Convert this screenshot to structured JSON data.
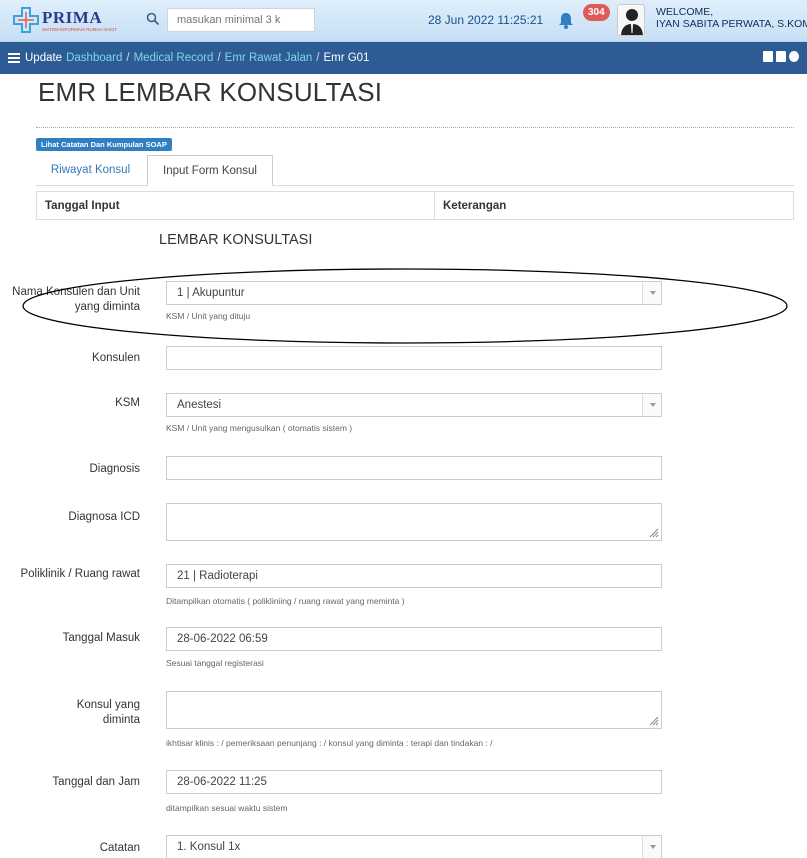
{
  "header": {
    "logo_text": "PRIMA",
    "logo_subtext": "SISTEM INFORMASI RUMAH SAKIT",
    "search_placeholder": "masukan minimal 3 k",
    "datetime": "28 Jun 2022 11:25:21",
    "notification_count": "304",
    "welcome_label": "WELCOME,",
    "user_name": "IYAN SABITA PERWATA, S.KOM"
  },
  "breadcrumb": {
    "update_label": "Update",
    "items": [
      "Dashboard",
      "Medical Record",
      "Emr Rawat Jalan"
    ],
    "current": "Emr G01"
  },
  "page": {
    "title": "EMR LEMBAR KONSULTASI",
    "soap_button": "Lihat Catatan Dan Kumpulan SOAP",
    "tabs": [
      "Riwayat Konsul",
      "Input Form Konsul"
    ],
    "active_tab": "Input Form Konsul",
    "table_headers": [
      "Tanggal Input",
      "Keterangan"
    ],
    "section_title": "LEMBAR KONSULTASI"
  },
  "form": {
    "nama_konsulen": {
      "label": "Nama Konsulen dan Unit yang diminta",
      "value": "1 | Akupuntur",
      "help": "KSM / Unit yang dituju"
    },
    "konsulen": {
      "label": "Konsulen",
      "value": ""
    },
    "ksm": {
      "label": "KSM",
      "value": "Anestesi",
      "help": "KSM / Unit yang mengusulkan ( otomatis sistem )"
    },
    "diagnosis": {
      "label": "Diagnosis",
      "value": ""
    },
    "diagnosa_icd": {
      "label": "Diagnosa ICD",
      "value": ""
    },
    "poliklinik": {
      "label": "Poliklinik / Ruang rawat",
      "value": "21 | Radioterapi",
      "help": "Ditampilkan otomatis ( polikliniing / ruang rawat yang meminta )"
    },
    "tanggal_masuk": {
      "label": "Tanggal Masuk",
      "value": "28-06-2022 06:59",
      "help": "Sesuai tanggal registerasi"
    },
    "konsul_diminta": {
      "label": "Konsul yang diminta",
      "value": "",
      "help": "ikhtisar klinis : / pemeriksaan penunjang : / konsul yang diminta : terapi dan tindakan : /"
    },
    "tanggal_jam": {
      "label": "Tanggal dan Jam",
      "value": "28-06-2022 11:25",
      "help": "ditampilkan sesuai waktu sistem"
    },
    "catatan": {
      "label": "Catatan",
      "value": "1. Konsul 1x"
    }
  },
  "colors": {
    "navbar": "#2d5c94",
    "link": "#337ab7",
    "breadcrumb_link": "#7fd6ea",
    "badge": "#e05a5a",
    "soap_button": "#2f7fc2"
  }
}
